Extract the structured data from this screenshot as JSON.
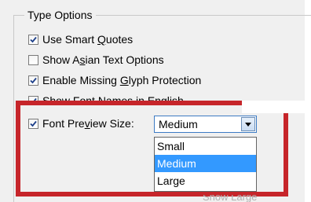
{
  "group": {
    "title": "Type Options"
  },
  "options": [
    {
      "before": "Use Smart ",
      "mnemonic": "Q",
      "after": "uotes",
      "checked": true
    },
    {
      "before": "Show A",
      "mnemonic": "s",
      "after": "ian Text Options",
      "checked": false
    },
    {
      "before": "Enable Missing ",
      "mnemonic": "G",
      "after": "lyph Protection",
      "checked": true
    },
    {
      "before": "Show Font Names in English",
      "mnemonic": "",
      "after": "",
      "checked": true
    }
  ],
  "font_preview": {
    "label_before": "Font Pre",
    "label_mnemonic": "v",
    "label_after": "iew Size:",
    "checked": true,
    "selected": "Medium",
    "options": [
      "Small",
      "Medium",
      "Large"
    ],
    "dropdown_open": true
  },
  "partial_text_below": "Show Large",
  "colors": {
    "highlight_border": "#c6252a",
    "selection": "#3399ff",
    "panel_bg": "#f0f0f0"
  },
  "icons": {
    "checkbox_checked": "checkmark-icon",
    "dropdown_arrow": "chevron-down-icon"
  }
}
